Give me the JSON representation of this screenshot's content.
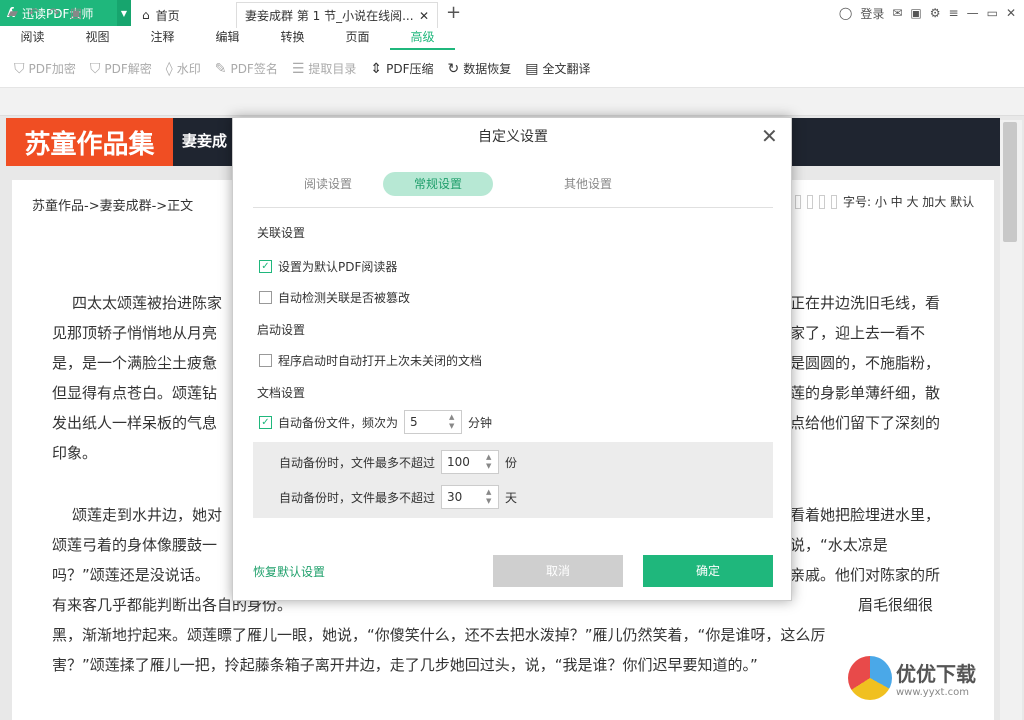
{
  "app": {
    "name": "迅读PDF大师",
    "login": "登录"
  },
  "menu": [
    "阅读",
    "视图",
    "注释",
    "编辑",
    "转换",
    "页面",
    "高级"
  ],
  "menu_active": "高级",
  "toolbar": [
    {
      "icon": "shield-icon",
      "label": "PDF加密",
      "enabled": false
    },
    {
      "icon": "shield-icon",
      "label": "PDF解密",
      "enabled": false
    },
    {
      "icon": "drop-icon",
      "label": "水印",
      "enabled": false
    },
    {
      "icon": "pen-icon",
      "label": "PDF签名",
      "enabled": false
    },
    {
      "icon": "list-icon",
      "label": "提取目录",
      "enabled": false
    },
    {
      "icon": "compress-icon",
      "label": "PDF压缩",
      "enabled": true
    },
    {
      "icon": "restore-icon",
      "label": "数据恢复",
      "enabled": true
    },
    {
      "icon": "translate-icon",
      "label": "全文翻译",
      "enabled": true
    }
  ],
  "tabs": {
    "home": "首页",
    "doc": "妻妾成群 第 1 节_小说在线阅..."
  },
  "doc": {
    "banner_title": "苏童作品集",
    "banner_sub": "妻妾成",
    "crumb": "苏童作品->妻妾成群->正文",
    "font_ctl": "字号: 小 中 大 加大  默认",
    "para_left": [
      "四太太颂莲被抬进陈家",
      "见那顶轿子悄悄地从月亮",
      "是，是一个满脸尘土疲惫",
      "但显得有点苍白。颂莲钻",
      "发出纸人一样呆板的气息",
      "印象。"
    ],
    "para_right": [
      "正在井边洗旧毛线，看",
      "家了，迎上去一看不",
      "是圆圆的，不施脂粉，",
      "莲的身影单薄纤细，散",
      "点给他们留下了深刻的"
    ],
    "para2_left": [
      "颂莲走到水井边，她对",
      "颂莲弓着的身体像腰鼓一"
    ],
    "para2_right": [
      "看着她把脸埋进水里，",
      "说，“水太凉是"
    ],
    "line_a": "吗？”颂莲还是没说话。",
    "line_a_right": "亲戚。他们对陈家的所",
    "line_b": "有来客几乎都能判断出各自的身份。",
    "line_b_right": "眉毛很细很",
    "line_c": "黑，渐渐地拧起来。颂莲瞟了雁儿一眼，她说，“你傻笑什么，还不去把水泼掉？”雁儿仍然笑着，“你是谁呀，这么厉",
    "line_d": "害？”颂莲揉了雁儿一把，拎起藤条箱子离开井边，走了几步她回过头，说，“我是谁？你们迟早要知道的。”"
  },
  "dialog": {
    "title": "自定义设置",
    "tabs": [
      "阅读设置",
      "常规设置",
      "其他设置"
    ],
    "active_tab": "常规设置",
    "sec_assoc": "关联设置",
    "opt_default": "设置为默认PDF阅读器",
    "opt_default_checked": true,
    "opt_detect": "自动检测关联是否被篡改",
    "opt_detect_checked": false,
    "sec_startup": "启动设置",
    "opt_reopen": "程序启动时自动打开上次未关闭的文档",
    "opt_reopen_checked": false,
    "sec_doc": "文档设置",
    "opt_backup": "自动备份文件，频次为",
    "opt_backup_checked": true,
    "backup_freq": "5",
    "unit_min": "分钟",
    "max_files_label": "自动备份时，文件最多不超过",
    "max_files": "100",
    "unit_copies": "份",
    "max_days_label": "自动备份时，文件最多不超过",
    "max_days": "30",
    "unit_days": "天",
    "restore": "恢复默认设置",
    "cancel": "取消",
    "ok": "确定"
  },
  "watermark": {
    "brand": "优优下载",
    "url": "www.yyxt.com"
  },
  "colors": {
    "accent": "#1fb77c",
    "banner": "#f04e23"
  }
}
